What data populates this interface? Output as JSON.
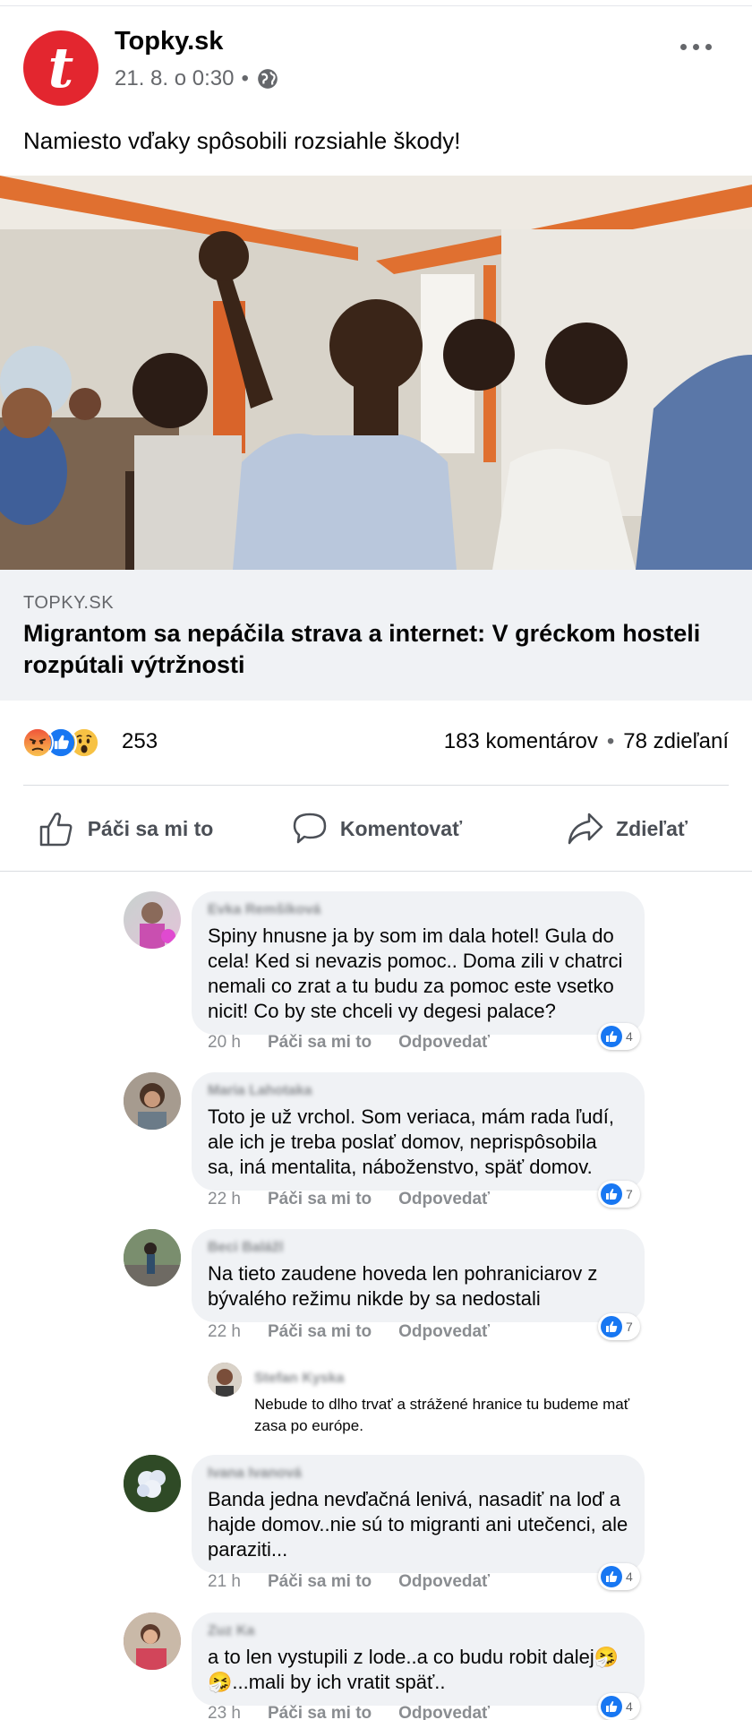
{
  "post": {
    "page_name": "Topky.sk",
    "logo_letter": "t",
    "timestamp": "21. 8. o 0:30",
    "separator": "•",
    "text": "Namiesto vďaky spôsobili rozsiahle škody!",
    "link": {
      "domain": "TOPKY.SK",
      "title": "Migrantom sa nepáčila strava a internet: V gréckom hosteli rozpútali výtržnosti"
    },
    "reactions": {
      "types": [
        "angry",
        "like",
        "wow"
      ],
      "count": "253"
    },
    "stats": {
      "comments": "183 komentárov",
      "separator": "•",
      "shares": "78 zdieľaní"
    },
    "actions": {
      "like": "Páči sa mi to",
      "comment": "Komentovať",
      "share": "Zdieľať"
    }
  },
  "comments": [
    {
      "author": "Evka Remšíková",
      "text": "Spiny hnusne ja by som im dala hotel! Gula do cela! Ked si nevazis pomoc.. Doma zili v chatrci nemali co zrat a tu budu za pomoc este vsetko nicit! Co by ste chceli vy degesi palace?",
      "time": "20 h",
      "like_label": "Páči sa mi to",
      "reply_label": "Odpovedať",
      "likes": "4"
    },
    {
      "author": "Maria Lahotaka",
      "text": "Toto je už vrchol. Som veriaca, mám rada ľudí, ale ich je treba poslať domov, neprispôsobila sa, iná mentalita, náboženstvo, späť domov.",
      "time": "22 h",
      "like_label": "Páči sa mi to",
      "reply_label": "Odpovedať",
      "likes": "7"
    },
    {
      "author": "Beci Balážl",
      "text": "Na tieto zaudene hoveda len pohraniciarov z bývalého režimu nikde by sa nedostali",
      "time": "22 h",
      "like_label": "Páči sa mi to",
      "reply_label": "Odpovedať",
      "likes": "7"
    },
    {
      "author": "Ivana Ivanová",
      "text": "Banda jedna nevďačná lenivá, nasadiť na loď a hajde domov..nie sú to migranti ani utečenci, ale paraziti...",
      "time": "21 h",
      "like_label": "Páči sa mi to",
      "reply_label": "Odpovedať",
      "likes": "4"
    },
    {
      "author": "Zuz Ka",
      "text": "a to len vystupili z lode..a co budu robit dalej🤧 🤧...mali by ich vratit späť..",
      "time": "23 h",
      "like_label": "Páči sa mi to",
      "reply_label": "Odpovedať",
      "likes": "4"
    }
  ],
  "reply": {
    "author": "Stefan Kyska",
    "text": "Nebude to dlho trvať a strážené hranice tu budeme mať zasa po európe."
  },
  "colors": {
    "brand_red": "#e3262f",
    "like_blue": "#1877f2",
    "bubble_bg": "#f0f2f5",
    "meta_gray": "#65676b"
  }
}
